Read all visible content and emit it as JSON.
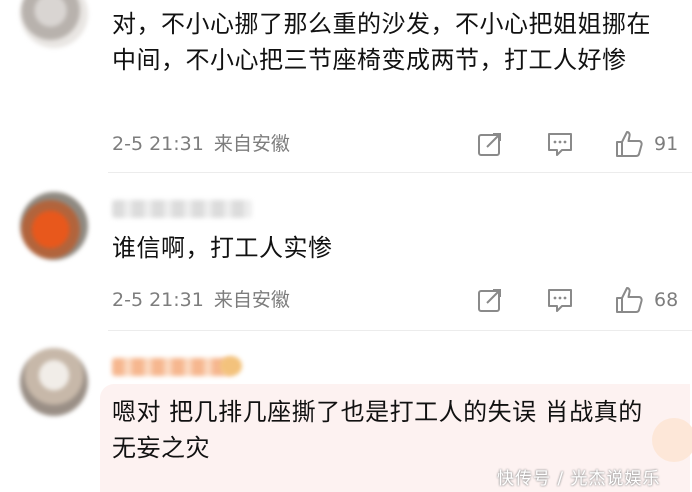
{
  "comments": [
    {
      "text": "对，不小心挪了那么重的沙发，不小心把姐姐挪在中间，不小心把三节座椅变成两节，打工人好惨",
      "time": "2-5 21:31",
      "location": "来自安徽",
      "likes": "91"
    },
    {
      "text": "谁信啊，打工人实惨",
      "time": "2-5 21:31",
      "location": "来自安徽",
      "likes": "68"
    },
    {
      "text": "嗯对 把几排几座撕了也是打工人的失误 肖战真的无妄之灾"
    }
  ],
  "watermark": "快传号 / 光杰说娱乐",
  "icons": {
    "share": "share-icon",
    "comment": "comment-icon",
    "like": "thumbs-up-icon"
  }
}
